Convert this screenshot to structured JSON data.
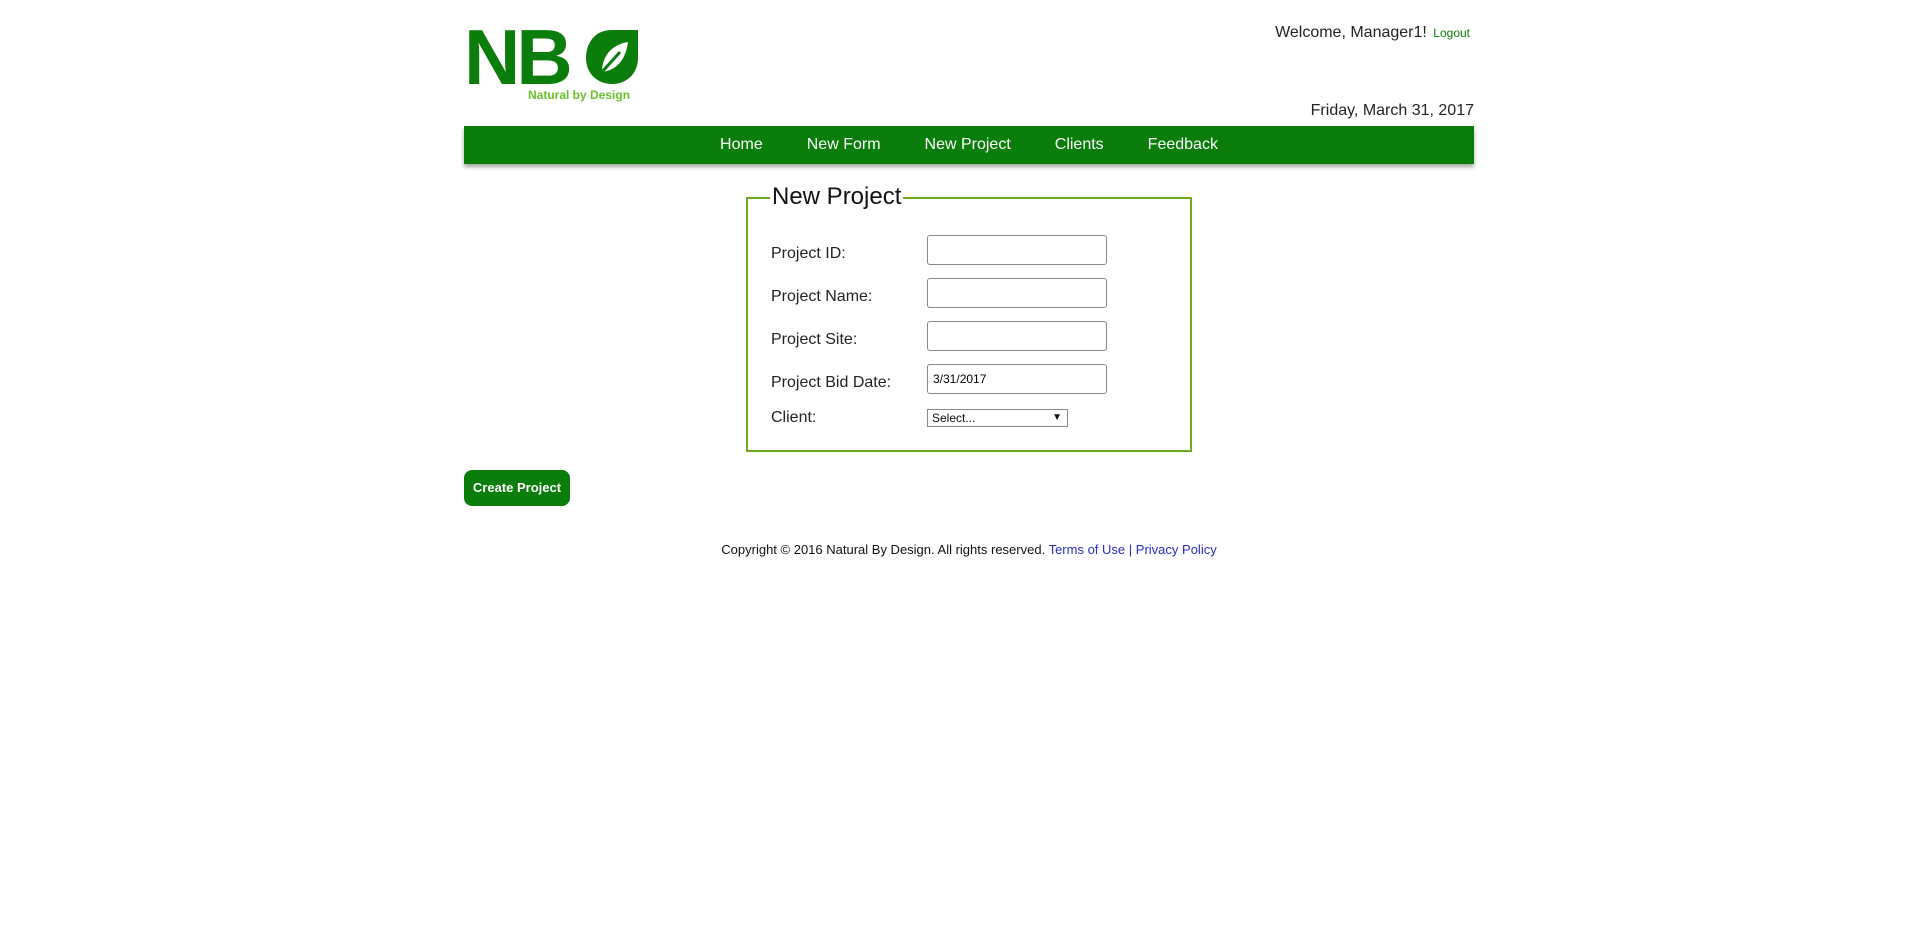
{
  "header": {
    "logo": {
      "letters": "NB",
      "tagline": "Natural by Design",
      "brand_color": "#0a7d0a",
      "accent_color": "#6abf2a"
    },
    "welcome_text": "Welcome, Manager1!",
    "logout_label": "Logout",
    "date": "Friday, March 31, 2017"
  },
  "nav": {
    "items": [
      {
        "label": "Home"
      },
      {
        "label": "New Form"
      },
      {
        "label": "New Project"
      },
      {
        "label": "Clients"
      },
      {
        "label": "Feedback"
      }
    ]
  },
  "form": {
    "legend": "New Project",
    "fields": {
      "project_id": {
        "label": "Project ID:",
        "value": ""
      },
      "project_name": {
        "label": "Project Name:",
        "value": ""
      },
      "project_site": {
        "label": "Project Site:",
        "value": ""
      },
      "project_bid_date": {
        "label": "Project Bid Date:",
        "value": "3/31/2017"
      },
      "client": {
        "label": "Client:",
        "selected": "Select..."
      }
    },
    "submit_label": "Create Project"
  },
  "footer": {
    "copyright": "Copyright © 2016 Natural By Design. All rights reserved.",
    "terms_label": "Terms of Use",
    "separator": "|",
    "privacy_label": "Privacy Policy"
  },
  "colors": {
    "nav_bg": "#0a7d0a",
    "fieldset_border": "#6aab1e",
    "link_blue": "#2a2acf"
  }
}
